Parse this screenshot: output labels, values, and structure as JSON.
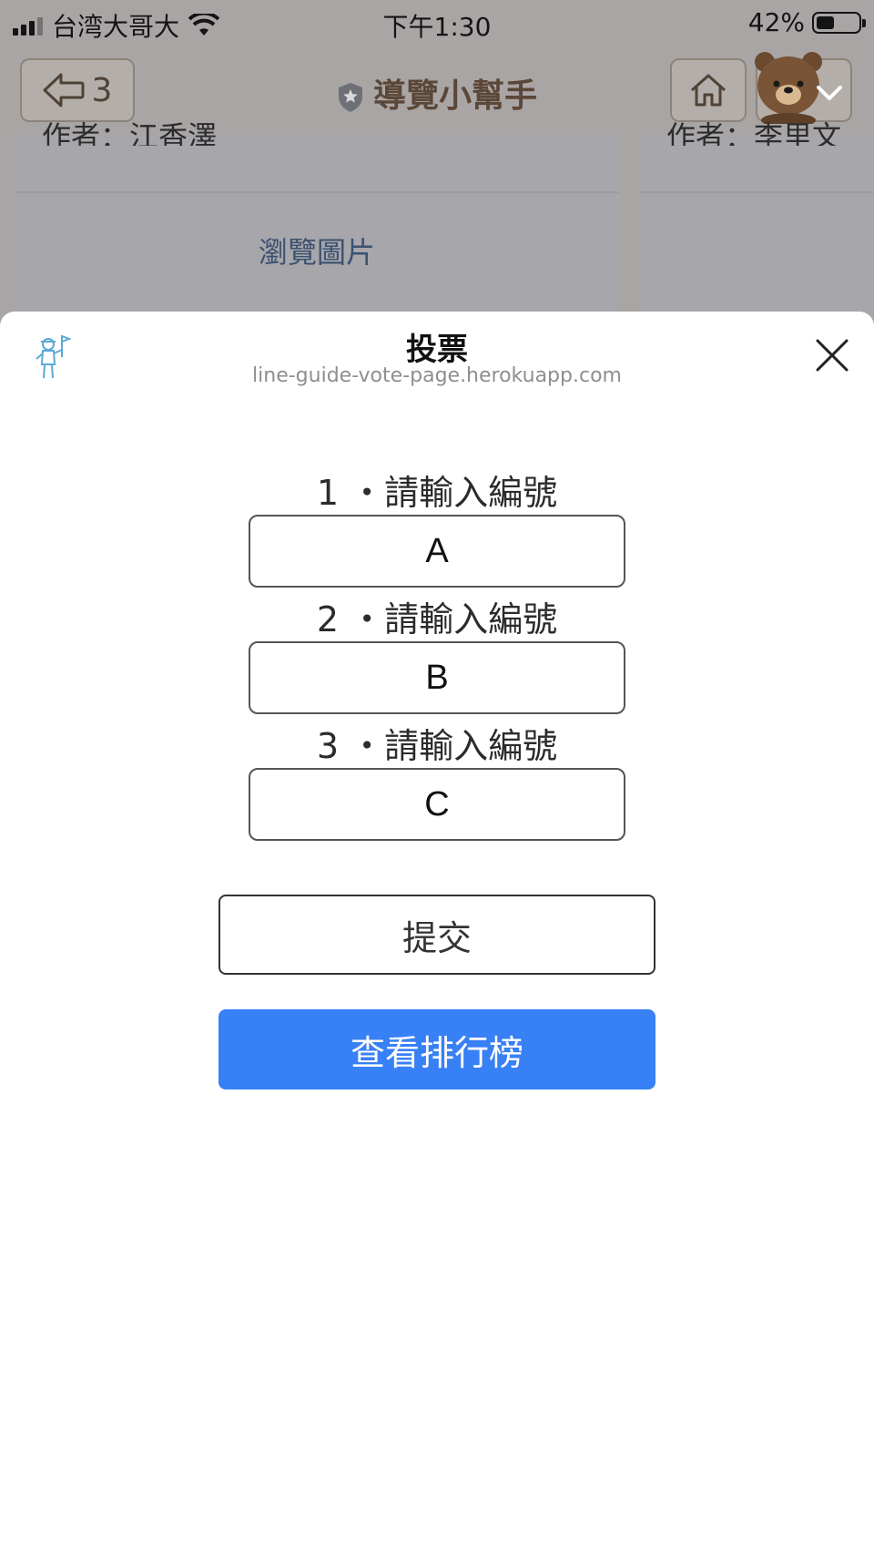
{
  "status_bar": {
    "carrier": "台湾大哥大",
    "time": "下午1:30",
    "battery": "42%"
  },
  "nav": {
    "back_count": "3",
    "title": "導覽小幫手"
  },
  "background_cards": {
    "left_author": "作者：江香澤",
    "right_author": "作者：李里文",
    "browse_label": "瀏覽圖片"
  },
  "sheet": {
    "title": "投票",
    "url": "line-guide-vote-page.herokuapp.com"
  },
  "form": {
    "fields": [
      {
        "label": "1 ・請輸入編號",
        "value": "A"
      },
      {
        "label": "2 ・請輸入編號",
        "value": "B"
      },
      {
        "label": "3 ・請輸入編號",
        "value": "C"
      }
    ],
    "submit_label": "提交",
    "ranking_label": "查看排行榜"
  },
  "colors": {
    "accent": "#3880f5",
    "dim_overlay": "#a9a5a4"
  }
}
